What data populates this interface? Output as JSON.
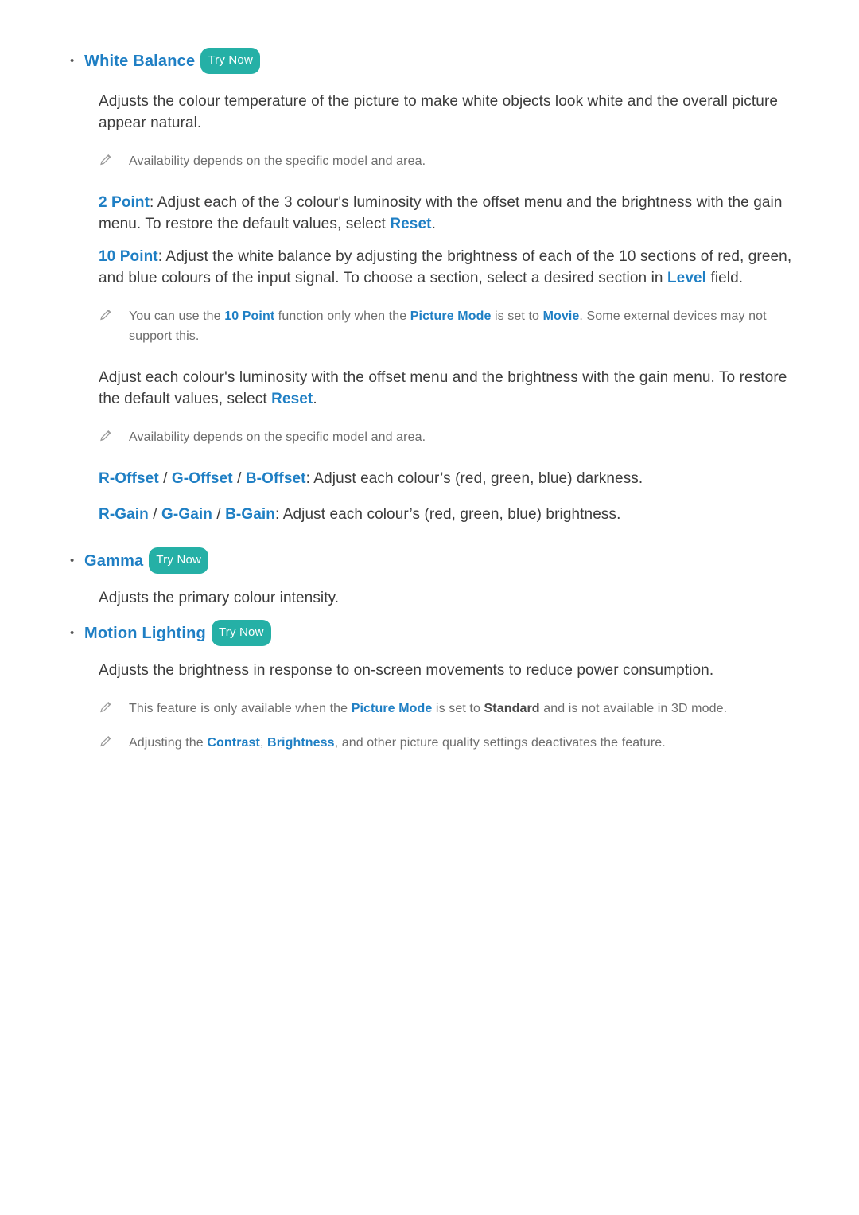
{
  "page": {
    "bullet_char": "•",
    "try_now_label": "Try Now",
    "pencil_icon_name": "pencil-note-icon"
  },
  "sections": {
    "white_balance": {
      "heading": "White Balance",
      "body": "Adjusts the colour temperature of the picture to make white objects look white and the overall picture appear natural.",
      "note1": "Availability depends on the specific model and area.",
      "two_point_label": "2 Point",
      "two_point_text": ": Adjust each of the 3 colour's luminosity with the offset menu and the brightness with the gain menu. To restore the default values, select ",
      "two_point_reset": "Reset",
      "two_point_end": ".",
      "ten_point_label": "10 Point",
      "ten_point_text": ": Adjust the white balance by adjusting the brightness of each of the 10 sections of red, green, and blue colours of the input signal. To choose a section, select a desired section in ",
      "ten_point_level": "Level",
      "ten_point_end": " field.",
      "note2_pre": "You can use the ",
      "note2_tenpoint": "10 Point",
      "note2_mid": " function only when the ",
      "note2_picturemode": "Picture Mode",
      "note2_mid2": " is set to ",
      "note2_movie": "Movie",
      "note2_end": ". Some external devices may not support this.",
      "adjust_para_pre": "Adjust each colour's luminosity with the offset menu and the brightness with the gain menu. To restore the default values, select ",
      "adjust_para_reset": "Reset",
      "adjust_para_end": ".",
      "note3": "Availability depends on the specific model and area.",
      "offset_r": "R-Offset",
      "offset_sep1": " / ",
      "offset_g": "G-Offset",
      "offset_sep2": " / ",
      "offset_b": "B-Offset",
      "offset_text": ": Adjust each colour’s (red, green, blue) darkness.",
      "gain_r": "R-Gain",
      "gain_sep1": " / ",
      "gain_g": "G-Gain",
      "gain_sep2": " / ",
      "gain_b": "B-Gain",
      "gain_text": ": Adjust each colour’s (red, green, blue) brightness."
    },
    "gamma": {
      "heading": "Gamma",
      "body": "Adjusts the primary colour intensity."
    },
    "motion_lighting": {
      "heading": "Motion Lighting",
      "body": "Adjusts the brightness in response to on-screen movements to reduce power consumption.",
      "note1_pre": "This feature is only available when the ",
      "note1_picturemode": "Picture Mode",
      "note1_mid": " is set to ",
      "note1_standard": "Standard",
      "note1_end": " and is not available in 3D mode.",
      "note2_pre": "Adjusting the ",
      "note2_contrast": "Contrast",
      "note2_comma": ", ",
      "note2_brightness": "Brightness",
      "note2_end": ", and other picture quality settings deactivates the feature."
    }
  },
  "colors": {
    "link_blue": "#1f7fc4",
    "try_now_teal": "#25b0a6",
    "body_text": "#3c3c3c",
    "note_text": "#6d6d6d"
  }
}
